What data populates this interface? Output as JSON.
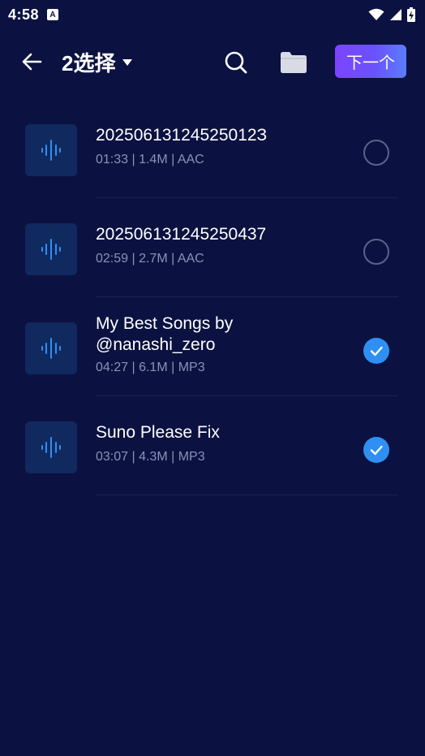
{
  "status_bar": {
    "time": "4:58",
    "notification_letter": "A"
  },
  "header": {
    "title": "2选择",
    "next_label": "下一个"
  },
  "files": [
    {
      "name": "20250613124525012З",
      "meta": "01:33 | 1.4M | AAC",
      "selected": false
    },
    {
      "name": "202506131245250437",
      "meta": "02:59 | 2.7M | AAC",
      "selected": false
    },
    {
      "name": "My Best Songs by @nanashi_zero",
      "meta": "04:27 | 6.1M | MP3",
      "selected": true
    },
    {
      "name": "Suno Please Fix",
      "meta": "03:07 | 4.3M | MP3",
      "selected": true
    }
  ],
  "colors": {
    "background": "#0b1241",
    "thumb_bg": "#10295e",
    "waveform": "#2f8ff3",
    "check_fill": "#2f8ff3",
    "meta_text": "#8a92b8",
    "accent_gradient_start": "#7b44ff",
    "accent_gradient_end": "#5a7dff"
  },
  "icons": {
    "back": "arrow-left-icon",
    "dropdown": "caret-down-icon",
    "search": "search-icon",
    "folder": "folder-icon",
    "wave": "audio-waveform-icon",
    "check": "check-icon"
  }
}
